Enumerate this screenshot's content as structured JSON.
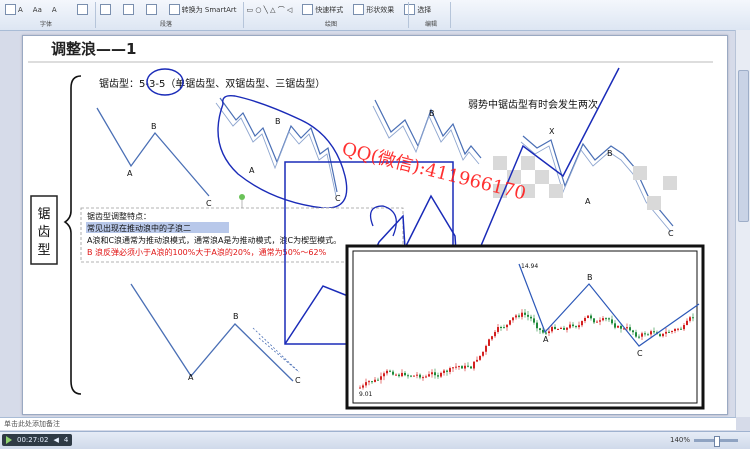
{
  "ribbon": {
    "items": [
      "转换为 SmartArt",
      "快速样式",
      "形状效果",
      "选择"
    ],
    "groups": [
      "字体",
      "段落",
      "绘图",
      "编辑"
    ]
  },
  "slide": {
    "title": "调整浪——1",
    "side_label": "锯齿型",
    "formula_prefix": "锯齿型：",
    "formula": "5-3-5",
    "formula_suffix": "（单锯齿型、双锯齿型、三锯齿型）",
    "weak_note": "弱势中锯齿型有时会发生两次",
    "watermark": "QQ(微信):411966170",
    "box": {
      "line1": "锯齿型调整特点：",
      "line2": "常见出现在推动浪中的子浪二",
      "line3": "A浪和C浪通常为推动浪模式，通常浪A是为推动模式，浪C为楔型模式。",
      "line4": "B 浪反弹必须小于A浪的100%大于A浪的20%，通常为50%～62%"
    },
    "chart_labels": {
      "top": "14.94",
      "bottom": "9.01"
    },
    "wave_labels": {
      "A": "A",
      "B": "B",
      "C": "C",
      "X": "X"
    }
  },
  "notes_text": "单击此处添加备注",
  "status": {
    "time": "00:27:02",
    "count": "4",
    "zoom": "140%"
  },
  "colors": {
    "accent": "#1a2bb8",
    "watermark": "#ff1a1a",
    "wave": "#4a6fb5",
    "red_text": "#e01515"
  }
}
